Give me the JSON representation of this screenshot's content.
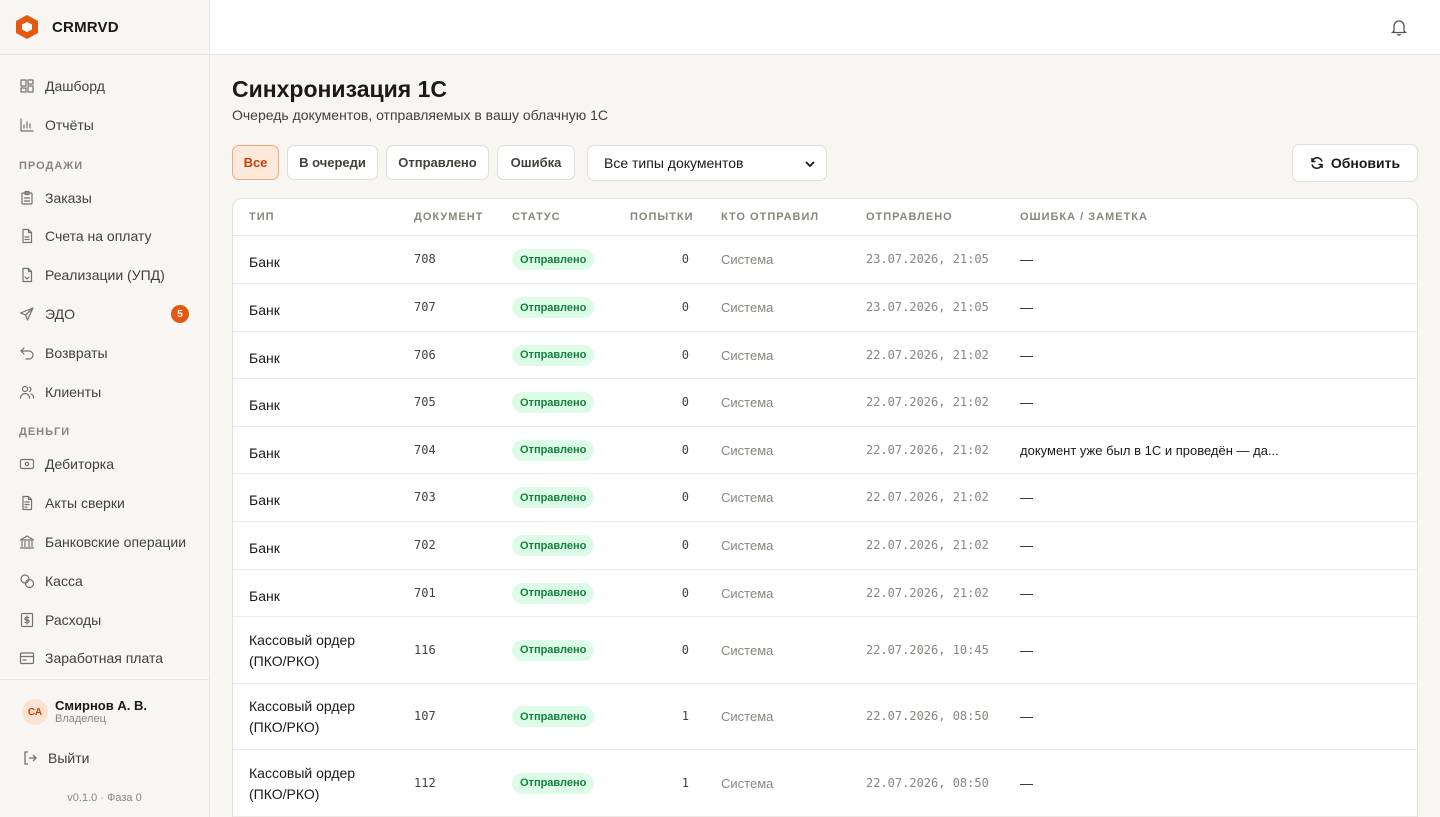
{
  "app": {
    "brand": "CRMRVD"
  },
  "sidebar": {
    "items_top": [
      {
        "label": "Дашборд",
        "icon": "dashboard-icon"
      },
      {
        "label": "Отчёты",
        "icon": "chart-icon"
      }
    ],
    "section_sales": "ПРОДАЖИ",
    "items_sales": [
      {
        "label": "Заказы",
        "icon": "clipboard-icon"
      },
      {
        "label": "Счета на оплату",
        "icon": "file-icon"
      },
      {
        "label": "Реализации (УПД)",
        "icon": "file-out-icon"
      },
      {
        "label": "ЭДО",
        "icon": "send-icon",
        "badge": "5"
      },
      {
        "label": "Возвраты",
        "icon": "undo-icon"
      },
      {
        "label": "Клиенты",
        "icon": "users-icon"
      }
    ],
    "section_money": "ДЕНЬГИ",
    "items_money": [
      {
        "label": "Дебиторка",
        "icon": "wallet-icon"
      },
      {
        "label": "Акты сверки",
        "icon": "file-check-icon"
      },
      {
        "label": "Банковские операции",
        "icon": "bank-icon"
      },
      {
        "label": "Касса",
        "icon": "coins-icon"
      },
      {
        "label": "Расходы",
        "icon": "receipt-icon"
      },
      {
        "label": "Заработная плата",
        "icon": "payroll-icon"
      }
    ],
    "user": {
      "initials": "СА",
      "name": "Смирнов А. В.",
      "role": "Владелец"
    },
    "logout": "Выйти",
    "version": "v0.1.0 · Фаза 0"
  },
  "header": {
    "notifications_icon": "bell-icon"
  },
  "main": {
    "title": "Синхронизация 1С",
    "subtitle": "Очередь документов, отправляемых в вашу облачную 1С",
    "filters": [
      "Все",
      "В очереди",
      "Отправлено",
      "Ошибка"
    ],
    "active_filter": "Все",
    "doc_type_select": "Все типы документов",
    "refresh_label": "Обновить"
  },
  "table": {
    "columns": [
      "ТИП",
      "ДОКУМЕНТ",
      "СТАТУС",
      "ПОПЫТКИ",
      "КТО ОТПРАВИЛ",
      "ОТПРАВЛЕНО",
      "ОШИБКА / ЗАМЕТКА"
    ],
    "rows": [
      {
        "type": "Банк",
        "doc": "708",
        "status": "Отправлено",
        "attempts": "0",
        "sender": "Система",
        "sent": "23.07.2026, 21:05",
        "note": "—"
      },
      {
        "type": "Банк",
        "doc": "707",
        "status": "Отправлено",
        "attempts": "0",
        "sender": "Система",
        "sent": "23.07.2026, 21:05",
        "note": "—"
      },
      {
        "type": "Банк",
        "doc": "706",
        "status": "Отправлено",
        "attempts": "0",
        "sender": "Система",
        "sent": "22.07.2026, 21:02",
        "note": "—"
      },
      {
        "type": "Банк",
        "doc": "705",
        "status": "Отправлено",
        "attempts": "0",
        "sender": "Система",
        "sent": "22.07.2026, 21:02",
        "note": "—"
      },
      {
        "type": "Банк",
        "doc": "704",
        "status": "Отправлено",
        "attempts": "0",
        "sender": "Система",
        "sent": "22.07.2026, 21:02",
        "note": "документ уже был в 1С и проведён — да..."
      },
      {
        "type": "Банк",
        "doc": "703",
        "status": "Отправлено",
        "attempts": "0",
        "sender": "Система",
        "sent": "22.07.2026, 21:02",
        "note": "—"
      },
      {
        "type": "Банк",
        "doc": "702",
        "status": "Отправлено",
        "attempts": "0",
        "sender": "Система",
        "sent": "22.07.2026, 21:02",
        "note": "—"
      },
      {
        "type": "Банк",
        "doc": "701",
        "status": "Отправлено",
        "attempts": "0",
        "sender": "Система",
        "sent": "22.07.2026, 21:02",
        "note": "—"
      },
      {
        "type": "Кассовый ордер\n(ПКО/РКО)",
        "doc": "116",
        "status": "Отправлено",
        "attempts": "0",
        "sender": "Система",
        "sent": "22.07.2026, 10:45",
        "note": "—"
      },
      {
        "type": "Кассовый ордер\n(ПКО/РКО)",
        "doc": "107",
        "status": "Отправлено",
        "attempts": "1",
        "sender": "Система",
        "sent": "22.07.2026, 08:50",
        "note": "—"
      },
      {
        "type": "Кассовый ордер\n(ПКО/РКО)",
        "doc": "112",
        "status": "Отправлено",
        "attempts": "1",
        "sender": "Система",
        "sent": "22.07.2026, 08:50",
        "note": "—"
      }
    ]
  },
  "colors": {
    "accent": "#e4590f",
    "status_ok_bg": "#dcfce7",
    "status_ok_text": "#15803d"
  }
}
